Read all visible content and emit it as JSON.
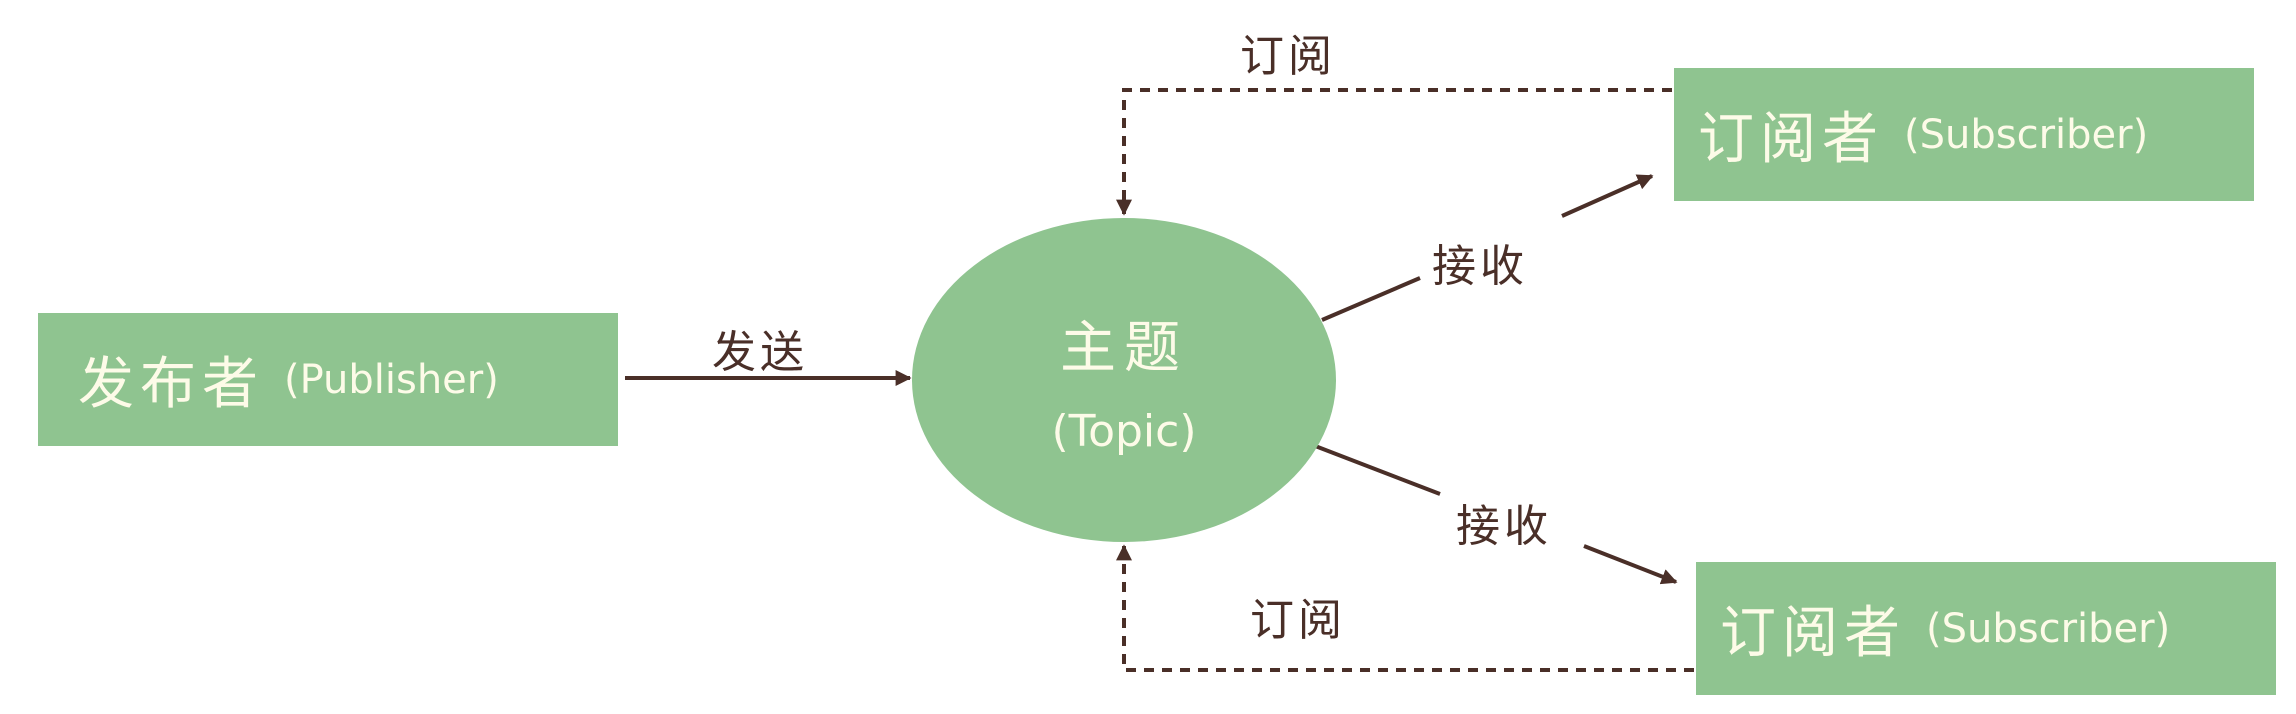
{
  "publisher": {
    "label": "发布者",
    "sublabel": "(Publisher)"
  },
  "topic": {
    "label": "主题",
    "sublabel": "(Topic)"
  },
  "subscribers": [
    {
      "label": "订阅者",
      "sublabel": "(Subscriber)"
    },
    {
      "label": "订阅者",
      "sublabel": "(Subscriber)"
    }
  ],
  "edges": {
    "send": "发送",
    "receive_top": "接收",
    "receive_bottom": "接收",
    "subscribe_top": "订阅",
    "subscribe_bottom": "订阅"
  },
  "colors": {
    "node_fill": "#8fc490",
    "node_text": "#fdfbe8",
    "line": "#4a2f28"
  }
}
